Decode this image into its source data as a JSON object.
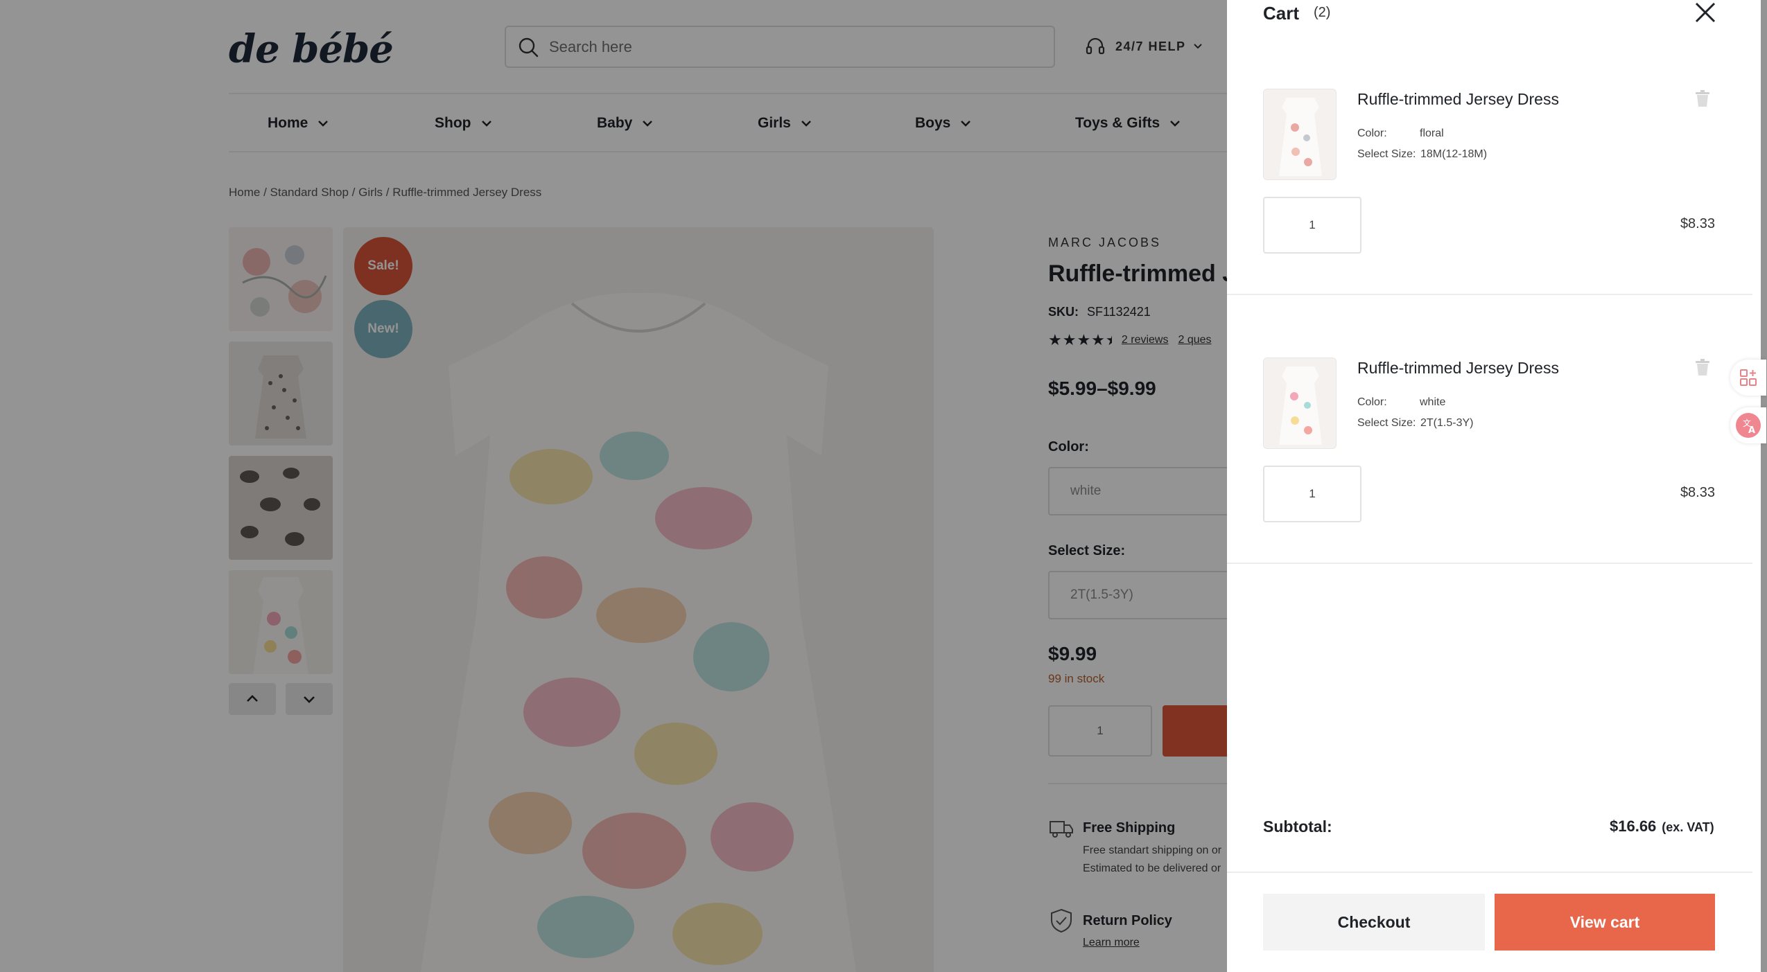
{
  "header": {
    "logo": "de bébé",
    "search_placeholder": "Search here",
    "help_label": "24/7 HELP"
  },
  "nav": [
    "Home",
    "Shop",
    "Baby",
    "Girls",
    "Boys",
    "Toys & Gifts"
  ],
  "breadcrumb": "Home / Standard Shop / Girls / Ruffle-trimmed Jersey Dress",
  "badges": {
    "sale": "Sale!",
    "new": "New!"
  },
  "product": {
    "brand": "MARC JACOBS",
    "title": "Ruffle-trimmed Je",
    "sku_label": "SKU:",
    "sku": "SF1132421",
    "rating": 4.5,
    "reviews_link": "2 reviews",
    "questions_link": "2 ques",
    "price_range": "$5.99–$9.99",
    "color_label": "Color:",
    "color_value": "white",
    "size_label": "Select Size:",
    "size_value": "2T(1.5-3Y)",
    "price": "$9.99",
    "stock": "99 in stock",
    "qty": "1",
    "features": [
      {
        "title": "Free Shipping",
        "line1": "Free standart shipping on or",
        "line2": "Estimated to be delivered or",
        "icon": "truck-icon"
      },
      {
        "title": "Return Policy",
        "link": "Learn more",
        "icon": "shield-icon"
      }
    ]
  },
  "cart": {
    "title": "Cart",
    "count": "(2)",
    "items": [
      {
        "name": "Ruffle-trimmed Jersey Dress",
        "color_label": "Color:",
        "color": "floral",
        "size_label": "Select Size:",
        "size": "18M(12-18M)",
        "qty": "1",
        "price": "$8.33"
      },
      {
        "name": "Ruffle-trimmed Jersey Dress",
        "color_label": "Color:",
        "color": "white",
        "size_label": "Select Size:",
        "size": "2T(1.5-3Y)",
        "qty": "1",
        "price": "$8.33"
      }
    ],
    "subtotal_label": "Subtotal:",
    "subtotal_value": "$16.66",
    "subtotal_note": "(ex. VAT)",
    "checkout_label": "Checkout",
    "viewcart_label": "View cart"
  },
  "colors": {
    "accent": "#e8674a",
    "sale_badge": "#d9553a",
    "new_badge": "#7fb2bd"
  }
}
